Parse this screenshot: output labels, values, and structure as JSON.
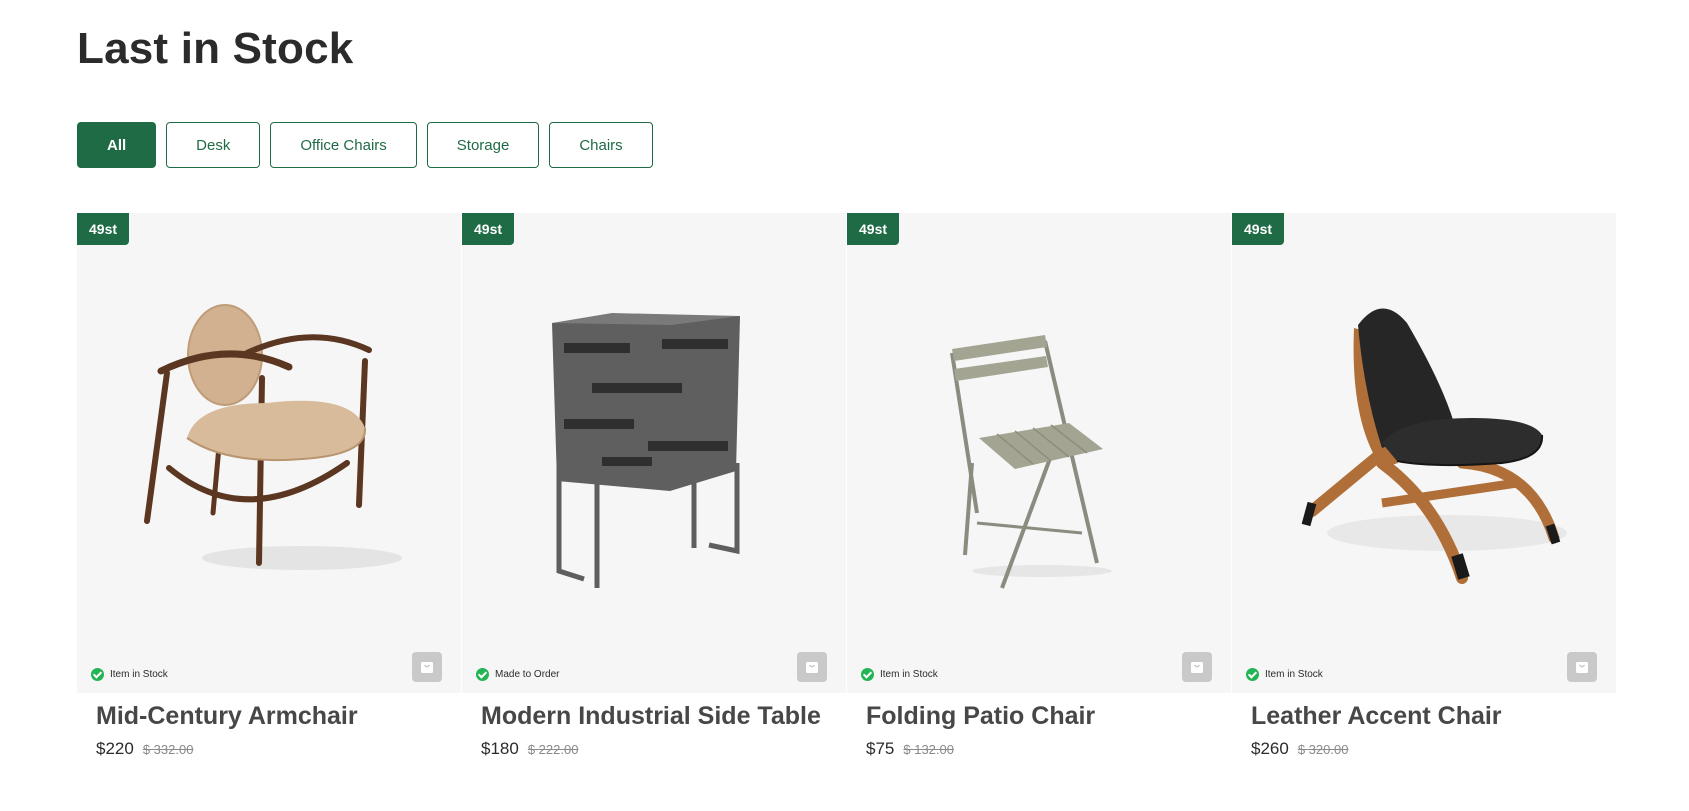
{
  "page": {
    "title": "Last in Stock"
  },
  "filters": [
    {
      "label": "All",
      "active": true
    },
    {
      "label": "Desk",
      "active": false
    },
    {
      "label": "Office Chairs",
      "active": false
    },
    {
      "label": "Storage",
      "active": false
    },
    {
      "label": "Chairs",
      "active": false
    }
  ],
  "products": [
    {
      "badge": "49st",
      "status": "Item in Stock",
      "name": "Mid-Century Armchair",
      "price": "$220",
      "old_price": "$ 332.00"
    },
    {
      "badge": "49st",
      "status": "Made to Order",
      "name": "Modern Industrial Side Table",
      "price": "$180",
      "old_price": "$ 222.00"
    },
    {
      "badge": "49st",
      "status": "Item in Stock",
      "name": "Folding Patio Chair",
      "price": "$75",
      "old_price": "$ 132.00"
    },
    {
      "badge": "49st",
      "status": "Item in Stock",
      "name": "Leather Accent Chair",
      "price": "$260",
      "old_price": "$ 320.00"
    }
  ],
  "colors": {
    "brand_green": "#1f6b45",
    "status_green": "#22b455",
    "card_background": "#f6f6f6",
    "cart_button": "#c9c9c9"
  },
  "icons": {
    "status": "check-circle-icon",
    "cart": "shopping-bag-icon"
  }
}
